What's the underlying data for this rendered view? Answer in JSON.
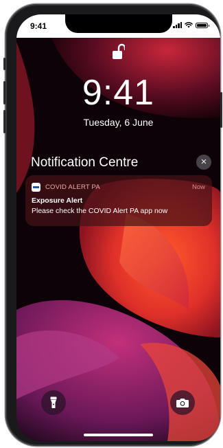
{
  "status_bar": {
    "time": "9:41"
  },
  "lock_screen": {
    "time": "9:41",
    "date": "Tuesday, 6 June"
  },
  "notification_centre": {
    "title": "Notification Centre",
    "close_symbol": "×"
  },
  "notification": {
    "app_name": "COVID ALERT PA",
    "timestamp": "Now",
    "title": "Exposure Alert",
    "body": "Please check the COVID Alert PA app now"
  },
  "icons": {
    "lock": "unlocked-padlock-icon",
    "flashlight": "flashlight-icon",
    "camera": "camera-icon",
    "signal": "cellular-signal-icon",
    "wifi": "wifi-icon",
    "battery": "battery-icon"
  },
  "colors": {
    "app_name": "#f0a9ae",
    "wallpaper_red": "#e0302a",
    "wallpaper_purple": "#7a1f6e"
  }
}
